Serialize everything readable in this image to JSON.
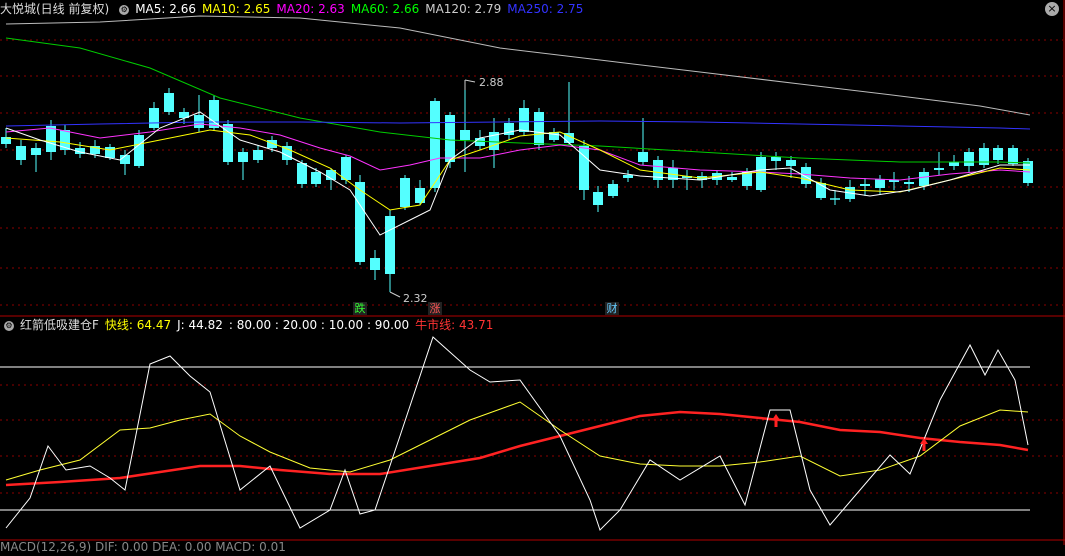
{
  "main_chart": {
    "title": "大悦城(日线 前复权)",
    "ma": [
      {
        "label": "MA5: 2.66",
        "color": "#ffffff"
      },
      {
        "label": "MA10: 2.65",
        "color": "#ffff00"
      },
      {
        "label": "MA20: 2.63",
        "color": "#ff00ff"
      },
      {
        "label": "MA60: 2.66",
        "color": "#00ff00"
      },
      {
        "label": "MA120: 2.79",
        "color": "#cccccc"
      },
      {
        "label": "MA250: 2.75",
        "color": "#3333ff"
      }
    ],
    "high_label": "2.88",
    "low_label": "2.32",
    "badges": [
      {
        "text": "跌",
        "color": "#33ff33"
      },
      {
        "text": "涨",
        "color": "#ff5555"
      },
      {
        "text": "财",
        "color": "#66ccff"
      }
    ]
  },
  "indicator": {
    "title": "红箭低吸建仓F",
    "fast_line": "快线: 64.47",
    "j_line": "J: 44.82",
    "levels": ": 80.00 : 20.00 : 10.00 : 90.00",
    "bull_line": "牛市线: 43.71"
  },
  "bottom": {
    "label": "MACD(12,26,9) DIF: 0.00 DEA: 0.00 MACD: 0.01"
  },
  "colors": {
    "up": "#ff3333",
    "down": "#54ffff",
    "grid": "#8b0000"
  }
}
